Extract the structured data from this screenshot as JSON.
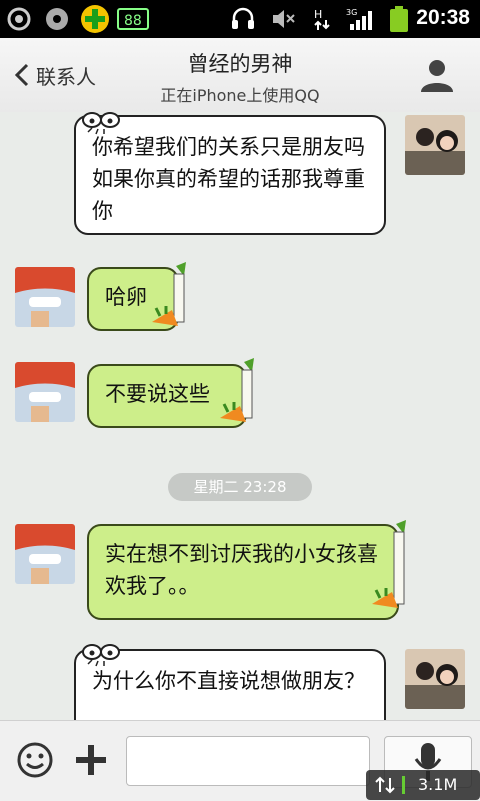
{
  "status_bar": {
    "time": "20:38",
    "icons": [
      "settings-icon",
      "disc-icon",
      "qihoo-plus-icon",
      "sdcard-icon",
      "headset-icon",
      "mute-icon",
      "data-arrows-icon",
      "signal-3g-icon",
      "battery-icon"
    ]
  },
  "header": {
    "back_label": "联系人",
    "title": "曾经的男神",
    "subtitle": "正在iPhone上使用QQ"
  },
  "messages": [
    {
      "side": "right",
      "text": "你希望我们的关系只是朋友吗 如果你真的希望的话那我尊重你"
    },
    {
      "side": "left",
      "text": "哈卵"
    },
    {
      "side": "left",
      "text": "不要说这些"
    },
    {
      "side": "left",
      "text": "实在想不到讨厌我的小女孩喜欢我了。。"
    },
    {
      "side": "right",
      "text": "为什么你不直接说想做朋友？"
    }
  ],
  "timestamp": "星期二 23:28",
  "input": {
    "placeholder": "",
    "value": ""
  },
  "network_badge": "3.1M",
  "colors": {
    "chat_bg": "#e9ece9",
    "left_bubble": "#cdee8a",
    "right_bubble": "#ffffff"
  }
}
